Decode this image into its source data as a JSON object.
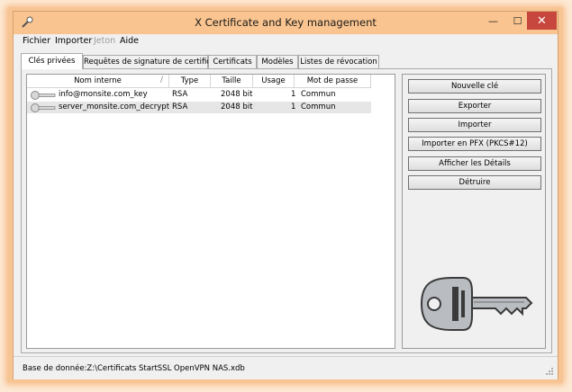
{
  "window": {
    "title": "X Certificate and Key management",
    "min_glyph": "—",
    "max_glyph": "☐",
    "close_glyph": "✕"
  },
  "menu": [
    "Fichier",
    "Importer",
    "Jeton",
    "Aide"
  ],
  "tabs": [
    "Clés privées",
    "Requêtes de signature de certificat",
    "Certificats",
    "Modèles",
    "Listes de révocation"
  ],
  "table": {
    "columns": [
      "Nom interne",
      "Type",
      "Taille",
      "Usage",
      "Mot de passe"
    ],
    "rows": [
      {
        "name": "info@monsite.com_key",
        "type": "RSA",
        "size": "2048 bit",
        "usage": "1",
        "password": "Commun"
      },
      {
        "name": "server_monsite.com_decrypt",
        "type": "RSA",
        "size": "2048 bit",
        "usage": "1",
        "password": "Commun"
      }
    ]
  },
  "buttons": [
    "Nouvelle clé",
    "Exporter",
    "Importer",
    "Importer en PFX (PKCS#12)",
    "Afficher les Détails",
    "Détruire"
  ],
  "status": "Base de donnée:Z:\\Certificats StartSSL OpenVPN NAS.xdb",
  "colors": {
    "titlebar": "#f9c48f",
    "close": "#c7463d",
    "frame_glow": "#f7c493"
  }
}
